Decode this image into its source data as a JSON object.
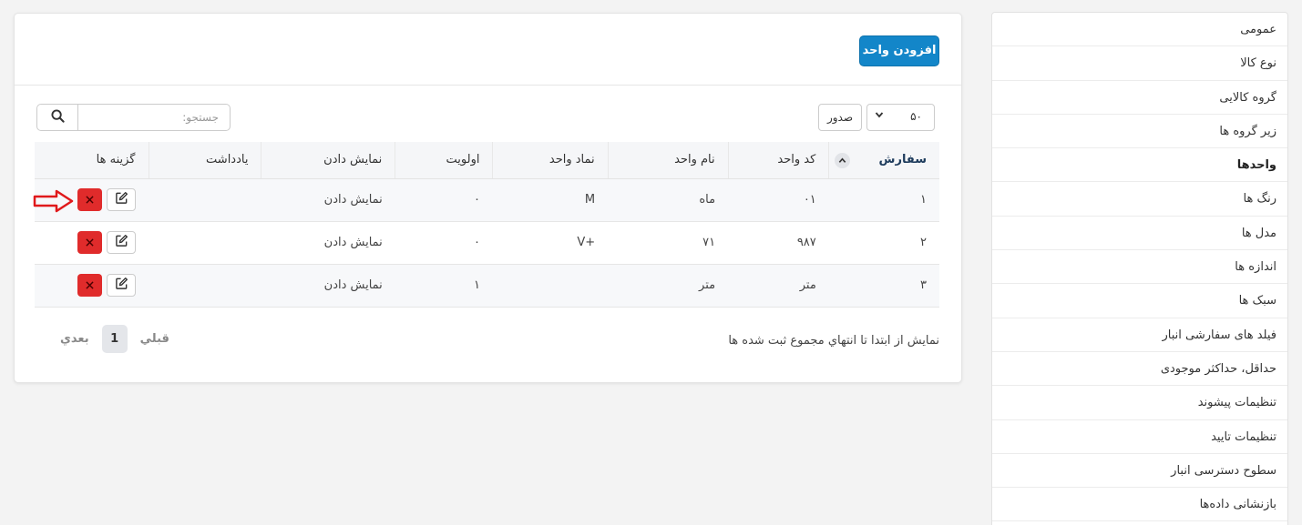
{
  "sidebar": {
    "items": [
      {
        "label": "عمومی",
        "active": false
      },
      {
        "label": "نوع کالا",
        "active": false
      },
      {
        "label": "گروه کالایی",
        "active": false
      },
      {
        "label": "زیر گروه ها",
        "active": false
      },
      {
        "label": "واحدها",
        "active": true
      },
      {
        "label": "رنگ ها",
        "active": false
      },
      {
        "label": "مدل ها",
        "active": false
      },
      {
        "label": "اندازه ها",
        "active": false
      },
      {
        "label": "سبک ها",
        "active": false
      },
      {
        "label": "فیلد های سفارشی انبار",
        "active": false
      },
      {
        "label": "حداقل، حداکثر موجودی",
        "active": false
      },
      {
        "label": "تنظیمات پیشوند",
        "active": false
      },
      {
        "label": "تنظیمات تایید",
        "active": false
      },
      {
        "label": "سطوح دسترسی انبار",
        "active": false
      },
      {
        "label": "بازنشانی داده‌ها",
        "active": false
      }
    ]
  },
  "header": {
    "add_button": "افزودن واحد"
  },
  "toolbar": {
    "page_length": "۵۰",
    "export_label": "صدور",
    "search_placeholder": "جستجو:"
  },
  "table": {
    "headers": {
      "order": "سفارش",
      "code": "کد واحد",
      "name": "نام واحد",
      "symbol": "نماد واحد",
      "priority": "اولویت",
      "display": "نمایش دادن",
      "note": "یادداشت",
      "options": "گزینه ها"
    },
    "rows": [
      {
        "order": "۱",
        "code": "۰۱",
        "name": "ماه",
        "symbol": "M",
        "priority": "۰",
        "display": "نمایش دادن",
        "note": ""
      },
      {
        "order": "۲",
        "code": "۹۸۷",
        "name": "۷۱",
        "symbol": "+V",
        "priority": "۰",
        "display": "نمایش دادن",
        "note": ""
      },
      {
        "order": "۳",
        "code": "متر",
        "name": "متر",
        "symbol": "",
        "priority": "۱",
        "display": "نمایش دادن",
        "note": ""
      }
    ]
  },
  "footer": {
    "info": "نمایش از ابتدا تا انتهاي مجموع ثبت شده ها",
    "prev": "قبلي",
    "page": "1",
    "next": "بعدي"
  },
  "colors": {
    "primary": "#1386c9",
    "danger": "#e02b2b",
    "annotation": "#e0191b"
  }
}
